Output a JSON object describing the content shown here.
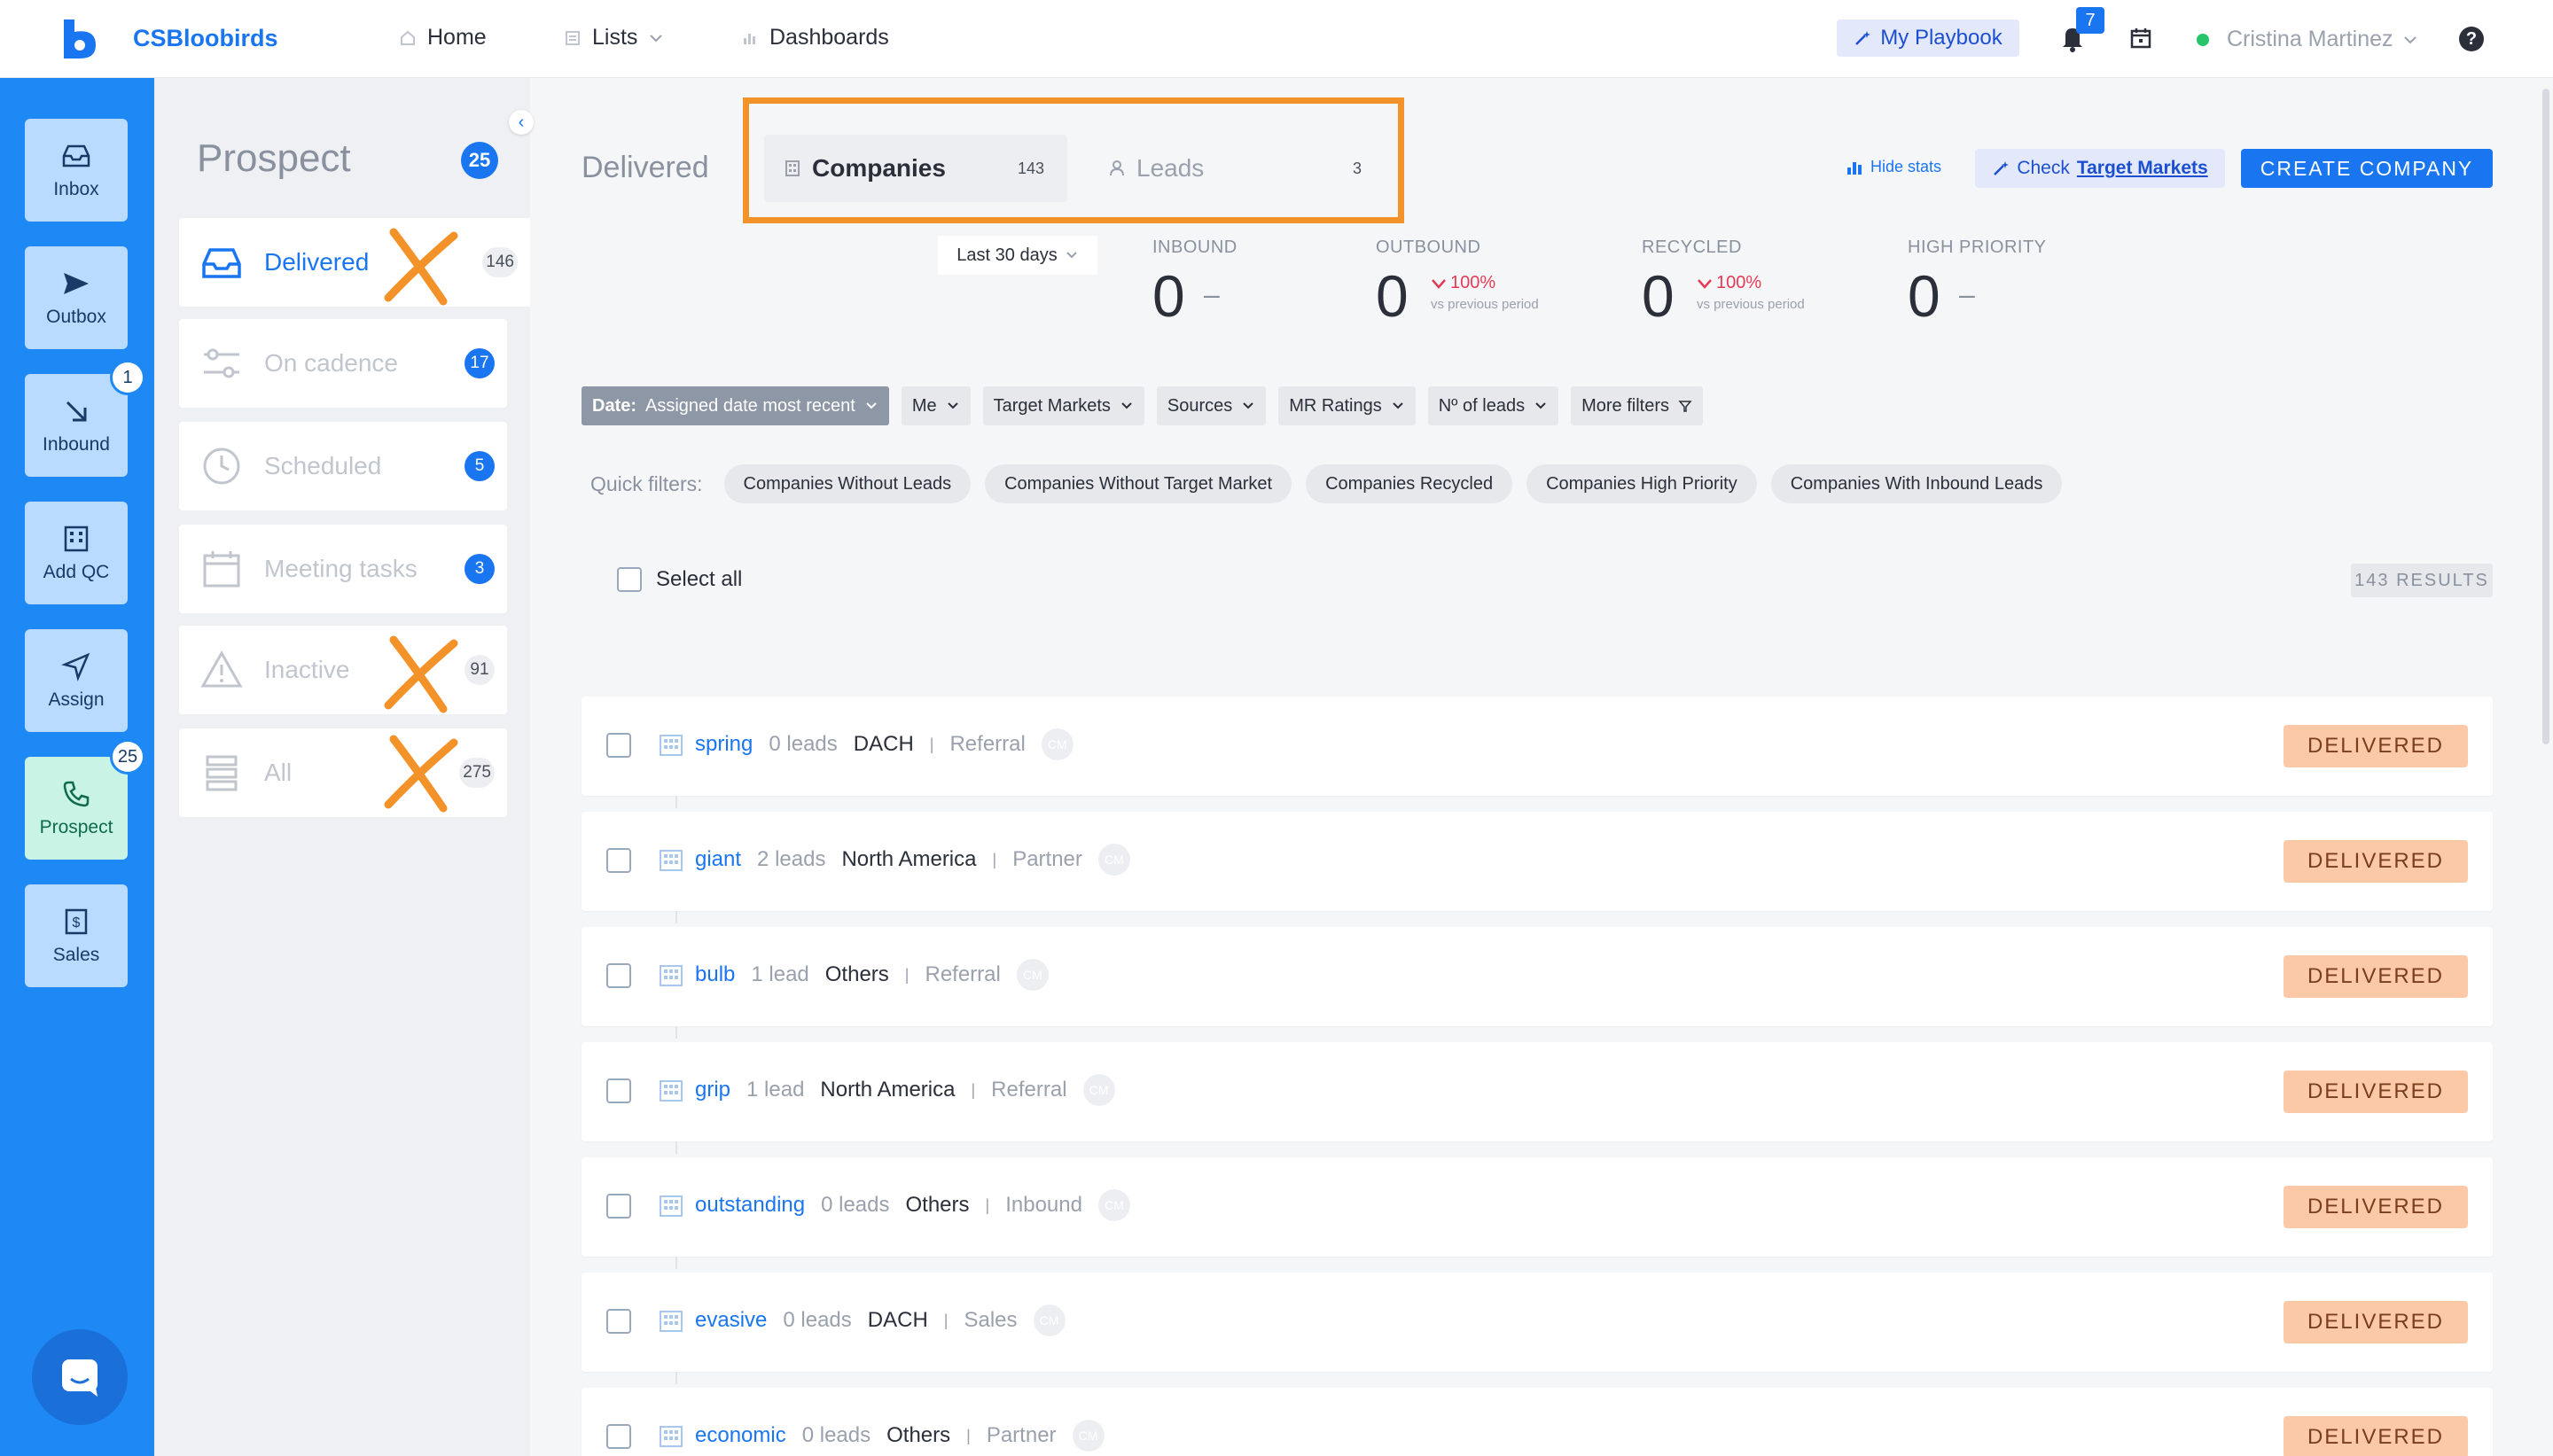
{
  "app": {
    "name": "CSBloobirds"
  },
  "topnav": {
    "items": [
      {
        "label": "Home",
        "icon": "home-icon"
      },
      {
        "label": "Lists",
        "icon": "list-icon"
      },
      {
        "label": "Dashboards",
        "icon": "chart-icon"
      }
    ],
    "playbook_label": "My Playbook",
    "notifications_count": "7",
    "user_name": "Cristina Martinez"
  },
  "rail": {
    "items": [
      {
        "label": "Inbox",
        "icon": "inbox-icon"
      },
      {
        "label": "Outbox",
        "icon": "send-icon"
      },
      {
        "label": "Inbound",
        "icon": "arrow-down-right-icon",
        "badge": "1"
      },
      {
        "label": "Add QC",
        "icon": "building-icon"
      },
      {
        "label": "Assign",
        "icon": "navigation-icon"
      },
      {
        "label": "Prospect",
        "icon": "phone-icon",
        "badge": "25"
      },
      {
        "label": "Sales",
        "icon": "dollar-icon"
      }
    ]
  },
  "sidebar": {
    "title": "Prospect",
    "count": "25",
    "items": [
      {
        "label": "Delivered",
        "count": "146"
      },
      {
        "label": "On cadence",
        "count": "17"
      },
      {
        "label": "Scheduled",
        "count": "5"
      },
      {
        "label": "Meeting tasks",
        "count": "3"
      },
      {
        "label": "Inactive",
        "count": "91"
      },
      {
        "label": "All",
        "count": "275"
      }
    ]
  },
  "main": {
    "title": "Delivered",
    "tabs": [
      {
        "label": "Companies",
        "count": "143"
      },
      {
        "label": "Leads",
        "count": "3"
      }
    ],
    "hide_stats_label": "Hide stats",
    "check_prefix": "Check",
    "check_link": "Target Markets",
    "create_label": "CREATE COMPANY",
    "period": "Last 30 days",
    "stats": [
      {
        "label": "INBOUND",
        "value": "0",
        "dash": "–"
      },
      {
        "label": "OUTBOUND",
        "value": "0",
        "change": "100%",
        "vs": "vs previous period"
      },
      {
        "label": "RECYCLED",
        "value": "0",
        "change": "100%",
        "vs": "vs previous period"
      },
      {
        "label": "HIGH PRIORITY",
        "value": "0",
        "dash": "–"
      }
    ],
    "filters": {
      "date_prefix": "Date:",
      "date_value": "Assigned date most recent",
      "items": [
        "Me",
        "Target Markets",
        "Sources",
        "MR Ratings",
        "Nº of leads",
        "More filters"
      ]
    },
    "quick_filters": {
      "label": "Quick filters:",
      "items": [
        "Companies Without Leads",
        "Companies Without Target Market",
        "Companies Recycled",
        "Companies High Priority",
        "Companies With Inbound Leads"
      ]
    },
    "select_all": "Select all",
    "results": "143 RESULTS",
    "rows": [
      {
        "name": "spring",
        "leads": "0 leads",
        "region": "DACH",
        "source": "Referral",
        "avatar": "CM",
        "status": "DELIVERED"
      },
      {
        "name": "giant",
        "leads": "2 leads",
        "region": "North America",
        "source": "Partner",
        "avatar": "CM",
        "status": "DELIVERED"
      },
      {
        "name": "bulb",
        "leads": "1 lead",
        "region": "Others",
        "source": "Referral",
        "avatar": "CM",
        "status": "DELIVERED"
      },
      {
        "name": "grip",
        "leads": "1 lead",
        "region": "North America",
        "source": "Referral",
        "avatar": "CM",
        "status": "DELIVERED"
      },
      {
        "name": "outstanding",
        "leads": "0 leads",
        "region": "Others",
        "source": "Inbound",
        "avatar": "CM",
        "status": "DELIVERED"
      },
      {
        "name": "evasive",
        "leads": "0 leads",
        "region": "DACH",
        "source": "Sales",
        "avatar": "CM",
        "status": "DELIVERED"
      },
      {
        "name": "economic",
        "leads": "0 leads",
        "region": "Others",
        "source": "Partner",
        "avatar": "CM",
        "status": "DELIVERED"
      }
    ]
  },
  "colors": {
    "accent": "#1976f0",
    "rail": "#1e88f5",
    "highlight": "#f4922a",
    "status_bg": "#fcc9a8",
    "negative": "#e53a55"
  }
}
